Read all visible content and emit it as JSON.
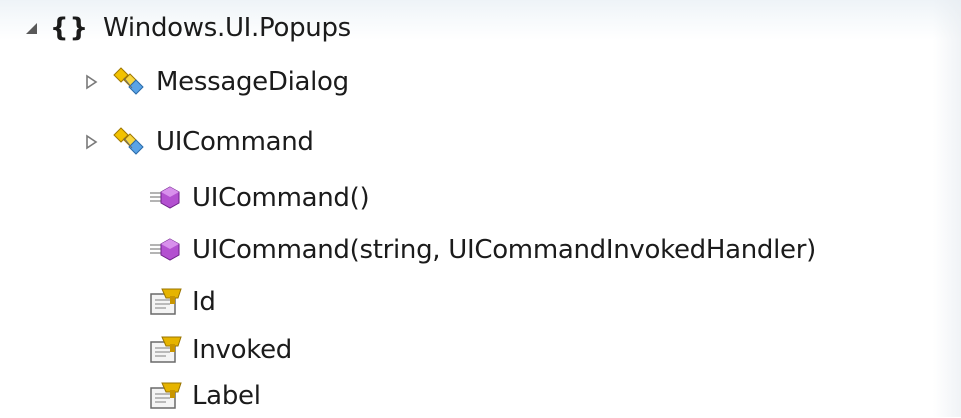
{
  "tree": {
    "namespace": {
      "label": "Windows.UI.Popups",
      "icon": "namespace-braces-icon",
      "braces": "{}",
      "expanded": true
    },
    "classes": [
      {
        "label": "MessageDialog",
        "icon": "class-icon",
        "expanded": false
      },
      {
        "label": "UICommand",
        "icon": "class-icon",
        "expanded": true,
        "members": [
          {
            "label": "UICommand()",
            "icon": "constructor-method-icon"
          },
          {
            "label": "UICommand(string, UICommandInvokedHandler)",
            "icon": "constructor-method-icon"
          },
          {
            "label": "Id",
            "icon": "property-icon"
          },
          {
            "label": "Invoked",
            "icon": "property-icon"
          },
          {
            "label": "Label",
            "icon": "property-icon"
          }
        ]
      }
    ]
  },
  "colors": {
    "text": "#1b1b1b",
    "expander": "#595959",
    "class_gold": "#e8b800",
    "class_blue": "#3c8fd6",
    "method_purple": "#9b3bb5",
    "property_gold": "#d9a400"
  }
}
